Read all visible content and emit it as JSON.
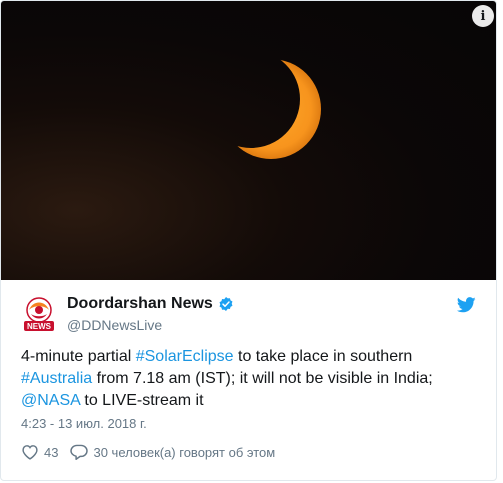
{
  "media": {
    "info_glyph": "i",
    "image_icon": "solar-eclipse-image",
    "sun_color": "#f7941d"
  },
  "author": {
    "name": "Doordarshan News",
    "handle": "@DDNewsLive",
    "avatar_text": "NEWS",
    "verified_color": "#1da1f2"
  },
  "tweet": {
    "text_1": "4-minute partial ",
    "hashtag_1": "#SolarEclipse",
    "text_2": " to take place in southern ",
    "hashtag_2": "#Australia",
    "text_3": " from 7.18 am (IST); it will not be visible in India; ",
    "mention": "@NASA",
    "text_4": " to LIVE-stream it"
  },
  "timestamp": "4:23 - 13 июл. 2018 г.",
  "actions": {
    "likes": "43",
    "replies_text": "30 человек(а) говорят об этом"
  },
  "colors": {
    "link": "#1b95e0",
    "text": "#14171a",
    "secondary": "#657786",
    "twitter_blue": "#1da1f2"
  }
}
